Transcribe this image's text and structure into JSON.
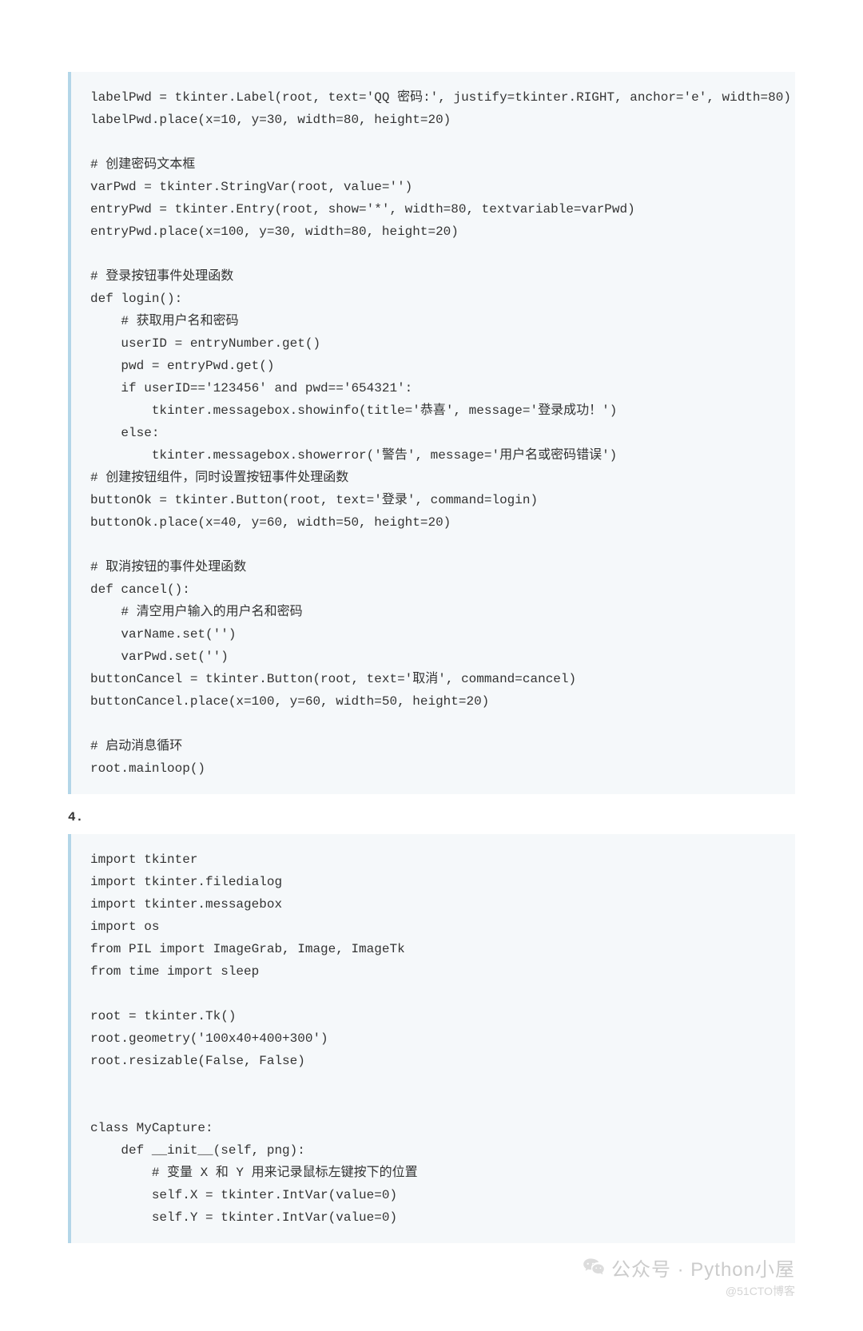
{
  "code_block_1": "labelPwd = tkinter.Label(root, text='QQ 密码:', justify=tkinter.RIGHT, anchor='e', width=80)\nlabelPwd.place(x=10, y=30, width=80, height=20)\n\n# 创建密码文本框\nvarPwd = tkinter.StringVar(root, value='')\nentryPwd = tkinter.Entry(root, show='*', width=80, textvariable=varPwd)\nentryPwd.place(x=100, y=30, width=80, height=20)\n\n# 登录按钮事件处理函数\ndef login():\n    # 获取用户名和密码\n    userID = entryNumber.get()\n    pwd = entryPwd.get()\n    if userID=='123456' and pwd=='654321':\n        tkinter.messagebox.showinfo(title='恭喜', message='登录成功！')\n    else:\n        tkinter.messagebox.showerror('警告', message='用户名或密码错误')\n# 创建按钮组件，同时设置按钮事件处理函数\nbuttonOk = tkinter.Button(root, text='登录', command=login)\nbuttonOk.place(x=40, y=60, width=50, height=20)\n\n# 取消按钮的事件处理函数\ndef cancel():\n    # 清空用户输入的用户名和密码\n    varName.set('')\n    varPwd.set('')\nbuttonCancel = tkinter.Button(root, text='取消', command=cancel)\nbuttonCancel.place(x=100, y=60, width=50, height=20)\n\n# 启动消息循环\nroot.mainloop()",
  "section_number": "4.",
  "code_block_2": "import tkinter\nimport tkinter.filedialog\nimport tkinter.messagebox\nimport os\nfrom PIL import ImageGrab, Image, ImageTk\nfrom time import sleep\n\nroot = tkinter.Tk()\nroot.geometry('100x40+400+300')\nroot.resizable(False, False)\n\n\nclass MyCapture:\n    def __init__(self, png):\n        # 变量 X 和 Y 用来记录鼠标左键按下的位置\n        self.X = tkinter.IntVar(value=0)\n        self.Y = tkinter.IntVar(value=0)",
  "watermark": {
    "main": "公众号 · Python小屋",
    "sub": "@51CTO博客"
  }
}
